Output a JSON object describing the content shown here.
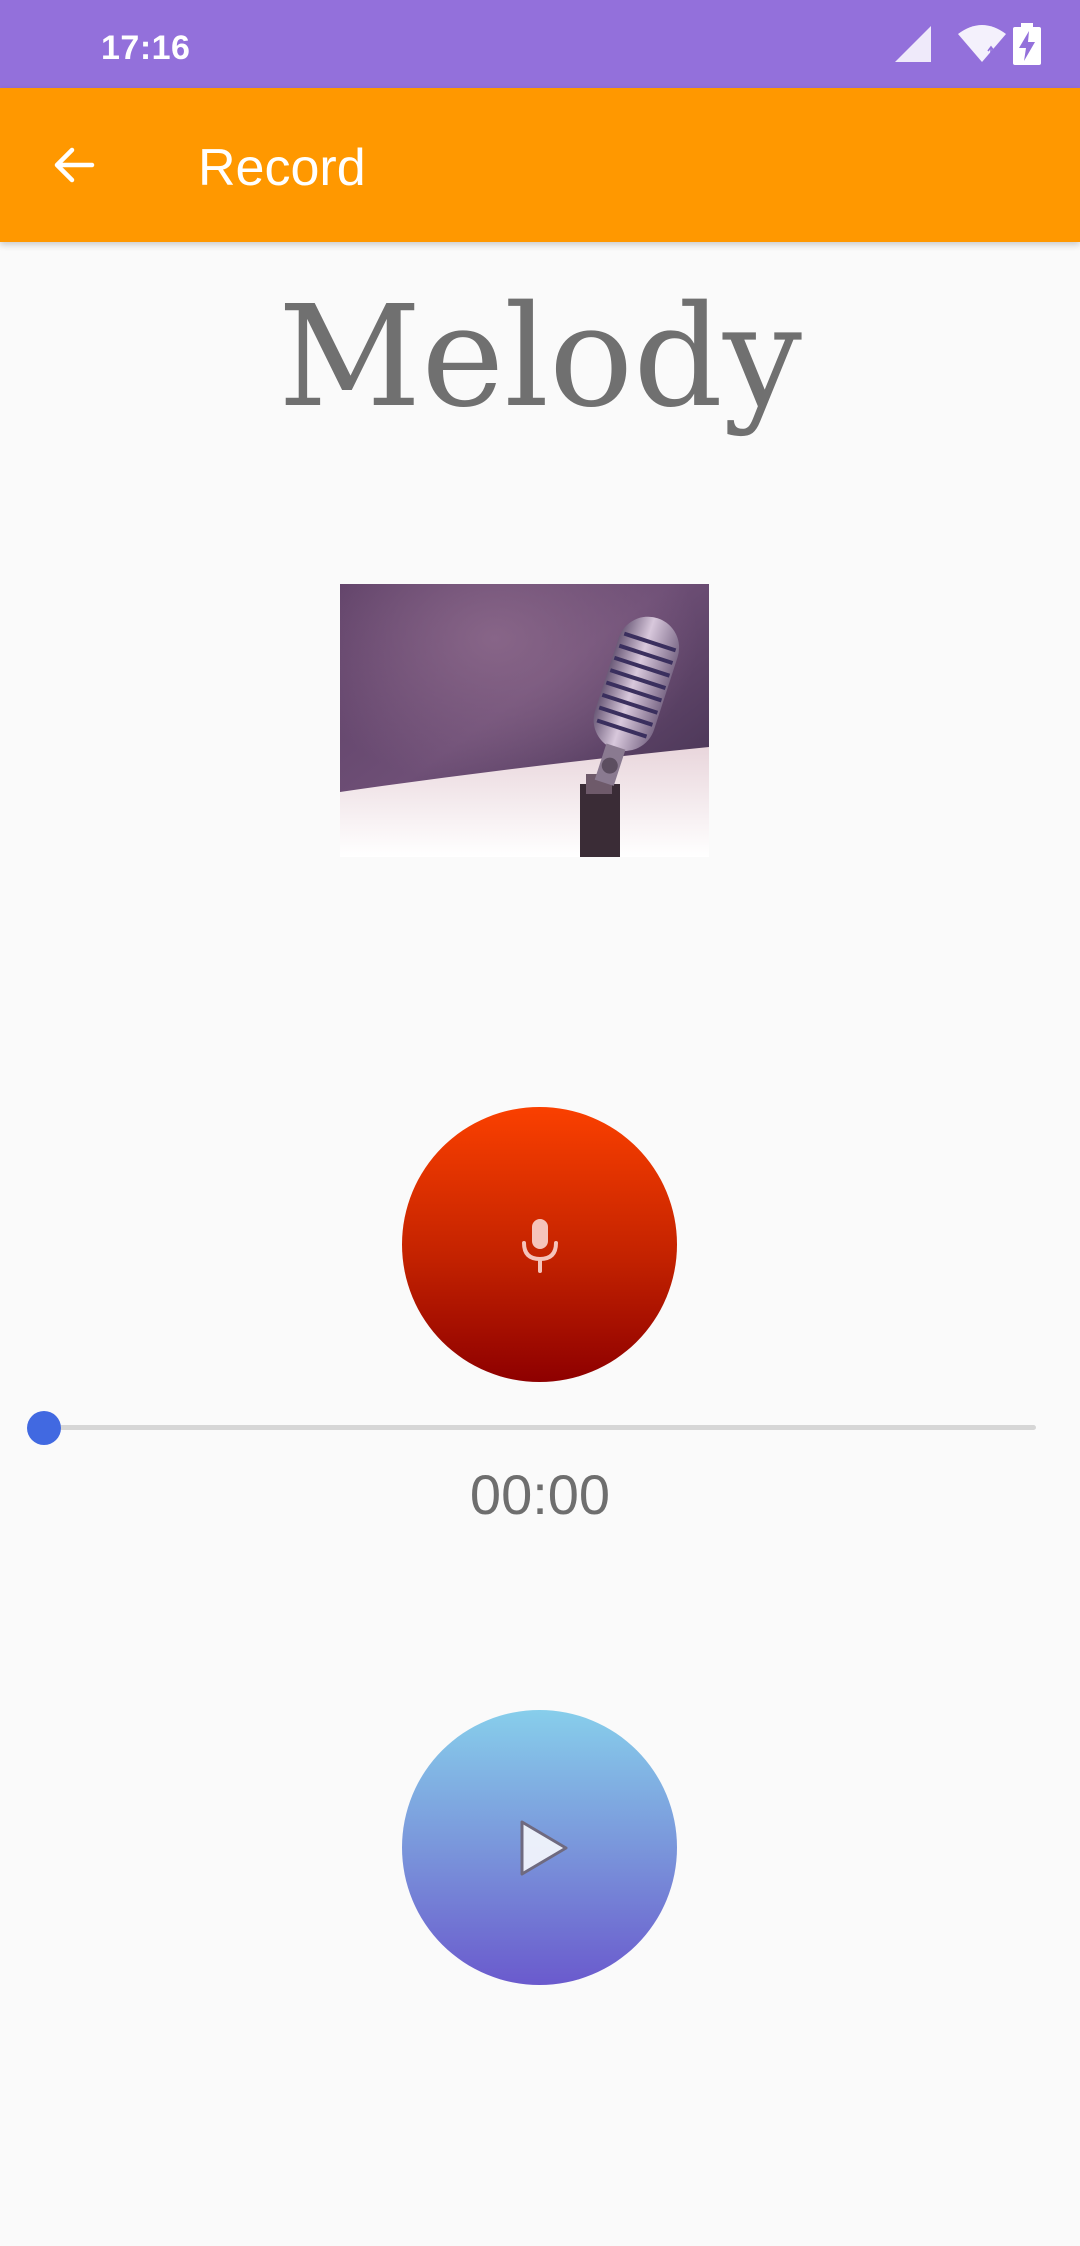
{
  "status_bar": {
    "time": "17:16",
    "icons": [
      "cell-signal-icon",
      "wifi-icon",
      "battery-charging-icon"
    ],
    "background_color": "#9370DB"
  },
  "app_bar": {
    "title": "Record",
    "back_icon": "arrow-back-icon",
    "background_color": "#FF9800"
  },
  "main": {
    "heading": "Melody",
    "image": "vintage-microphone-photo",
    "record_button": {
      "icon": "mic-icon",
      "gradient": [
        "#fa4000",
        "#8e0000"
      ]
    },
    "seekbar": {
      "progress": 0,
      "thumb_color": "#4169E1"
    },
    "time_display": "00:00",
    "play_button": {
      "icon": "play-icon",
      "gradient": [
        "#87CEEB",
        "#6A5ACD"
      ]
    }
  }
}
